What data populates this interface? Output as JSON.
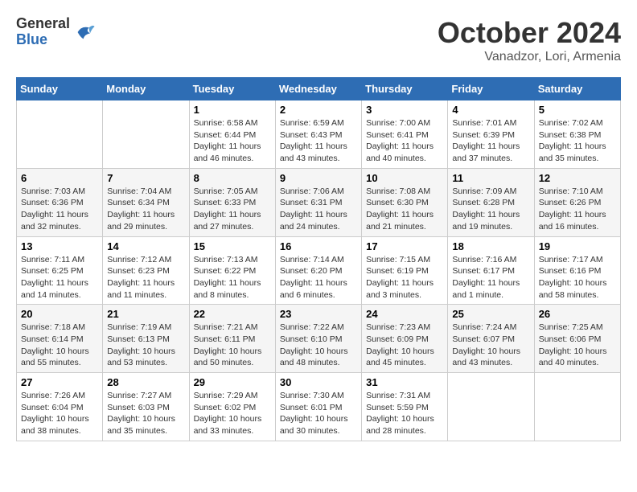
{
  "header": {
    "logo_general": "General",
    "logo_blue": "Blue",
    "month_title": "October 2024",
    "subtitle": "Vanadzor, Lori, Armenia"
  },
  "days_of_week": [
    "Sunday",
    "Monday",
    "Tuesday",
    "Wednesday",
    "Thursday",
    "Friday",
    "Saturday"
  ],
  "weeks": [
    [
      {
        "day": "",
        "sunrise": "",
        "sunset": "",
        "daylight": ""
      },
      {
        "day": "",
        "sunrise": "",
        "sunset": "",
        "daylight": ""
      },
      {
        "day": "1",
        "sunrise": "Sunrise: 6:58 AM",
        "sunset": "Sunset: 6:44 PM",
        "daylight": "Daylight: 11 hours and 46 minutes."
      },
      {
        "day": "2",
        "sunrise": "Sunrise: 6:59 AM",
        "sunset": "Sunset: 6:43 PM",
        "daylight": "Daylight: 11 hours and 43 minutes."
      },
      {
        "day": "3",
        "sunrise": "Sunrise: 7:00 AM",
        "sunset": "Sunset: 6:41 PM",
        "daylight": "Daylight: 11 hours and 40 minutes."
      },
      {
        "day": "4",
        "sunrise": "Sunrise: 7:01 AM",
        "sunset": "Sunset: 6:39 PM",
        "daylight": "Daylight: 11 hours and 37 minutes."
      },
      {
        "day": "5",
        "sunrise": "Sunrise: 7:02 AM",
        "sunset": "Sunset: 6:38 PM",
        "daylight": "Daylight: 11 hours and 35 minutes."
      }
    ],
    [
      {
        "day": "6",
        "sunrise": "Sunrise: 7:03 AM",
        "sunset": "Sunset: 6:36 PM",
        "daylight": "Daylight: 11 hours and 32 minutes."
      },
      {
        "day": "7",
        "sunrise": "Sunrise: 7:04 AM",
        "sunset": "Sunset: 6:34 PM",
        "daylight": "Daylight: 11 hours and 29 minutes."
      },
      {
        "day": "8",
        "sunrise": "Sunrise: 7:05 AM",
        "sunset": "Sunset: 6:33 PM",
        "daylight": "Daylight: 11 hours and 27 minutes."
      },
      {
        "day": "9",
        "sunrise": "Sunrise: 7:06 AM",
        "sunset": "Sunset: 6:31 PM",
        "daylight": "Daylight: 11 hours and 24 minutes."
      },
      {
        "day": "10",
        "sunrise": "Sunrise: 7:08 AM",
        "sunset": "Sunset: 6:30 PM",
        "daylight": "Daylight: 11 hours and 21 minutes."
      },
      {
        "day": "11",
        "sunrise": "Sunrise: 7:09 AM",
        "sunset": "Sunset: 6:28 PM",
        "daylight": "Daylight: 11 hours and 19 minutes."
      },
      {
        "day": "12",
        "sunrise": "Sunrise: 7:10 AM",
        "sunset": "Sunset: 6:26 PM",
        "daylight": "Daylight: 11 hours and 16 minutes."
      }
    ],
    [
      {
        "day": "13",
        "sunrise": "Sunrise: 7:11 AM",
        "sunset": "Sunset: 6:25 PM",
        "daylight": "Daylight: 11 hours and 14 minutes."
      },
      {
        "day": "14",
        "sunrise": "Sunrise: 7:12 AM",
        "sunset": "Sunset: 6:23 PM",
        "daylight": "Daylight: 11 hours and 11 minutes."
      },
      {
        "day": "15",
        "sunrise": "Sunrise: 7:13 AM",
        "sunset": "Sunset: 6:22 PM",
        "daylight": "Daylight: 11 hours and 8 minutes."
      },
      {
        "day": "16",
        "sunrise": "Sunrise: 7:14 AM",
        "sunset": "Sunset: 6:20 PM",
        "daylight": "Daylight: 11 hours and 6 minutes."
      },
      {
        "day": "17",
        "sunrise": "Sunrise: 7:15 AM",
        "sunset": "Sunset: 6:19 PM",
        "daylight": "Daylight: 11 hours and 3 minutes."
      },
      {
        "day": "18",
        "sunrise": "Sunrise: 7:16 AM",
        "sunset": "Sunset: 6:17 PM",
        "daylight": "Daylight: 11 hours and 1 minute."
      },
      {
        "day": "19",
        "sunrise": "Sunrise: 7:17 AM",
        "sunset": "Sunset: 6:16 PM",
        "daylight": "Daylight: 10 hours and 58 minutes."
      }
    ],
    [
      {
        "day": "20",
        "sunrise": "Sunrise: 7:18 AM",
        "sunset": "Sunset: 6:14 PM",
        "daylight": "Daylight: 10 hours and 55 minutes."
      },
      {
        "day": "21",
        "sunrise": "Sunrise: 7:19 AM",
        "sunset": "Sunset: 6:13 PM",
        "daylight": "Daylight: 10 hours and 53 minutes."
      },
      {
        "day": "22",
        "sunrise": "Sunrise: 7:21 AM",
        "sunset": "Sunset: 6:11 PM",
        "daylight": "Daylight: 10 hours and 50 minutes."
      },
      {
        "day": "23",
        "sunrise": "Sunrise: 7:22 AM",
        "sunset": "Sunset: 6:10 PM",
        "daylight": "Daylight: 10 hours and 48 minutes."
      },
      {
        "day": "24",
        "sunrise": "Sunrise: 7:23 AM",
        "sunset": "Sunset: 6:09 PM",
        "daylight": "Daylight: 10 hours and 45 minutes."
      },
      {
        "day": "25",
        "sunrise": "Sunrise: 7:24 AM",
        "sunset": "Sunset: 6:07 PM",
        "daylight": "Daylight: 10 hours and 43 minutes."
      },
      {
        "day": "26",
        "sunrise": "Sunrise: 7:25 AM",
        "sunset": "Sunset: 6:06 PM",
        "daylight": "Daylight: 10 hours and 40 minutes."
      }
    ],
    [
      {
        "day": "27",
        "sunrise": "Sunrise: 7:26 AM",
        "sunset": "Sunset: 6:04 PM",
        "daylight": "Daylight: 10 hours and 38 minutes."
      },
      {
        "day": "28",
        "sunrise": "Sunrise: 7:27 AM",
        "sunset": "Sunset: 6:03 PM",
        "daylight": "Daylight: 10 hours and 35 minutes."
      },
      {
        "day": "29",
        "sunrise": "Sunrise: 7:29 AM",
        "sunset": "Sunset: 6:02 PM",
        "daylight": "Daylight: 10 hours and 33 minutes."
      },
      {
        "day": "30",
        "sunrise": "Sunrise: 7:30 AM",
        "sunset": "Sunset: 6:01 PM",
        "daylight": "Daylight: 10 hours and 30 minutes."
      },
      {
        "day": "31",
        "sunrise": "Sunrise: 7:31 AM",
        "sunset": "Sunset: 5:59 PM",
        "daylight": "Daylight: 10 hours and 28 minutes."
      },
      {
        "day": "",
        "sunrise": "",
        "sunset": "",
        "daylight": ""
      },
      {
        "day": "",
        "sunrise": "",
        "sunset": "",
        "daylight": ""
      }
    ]
  ]
}
